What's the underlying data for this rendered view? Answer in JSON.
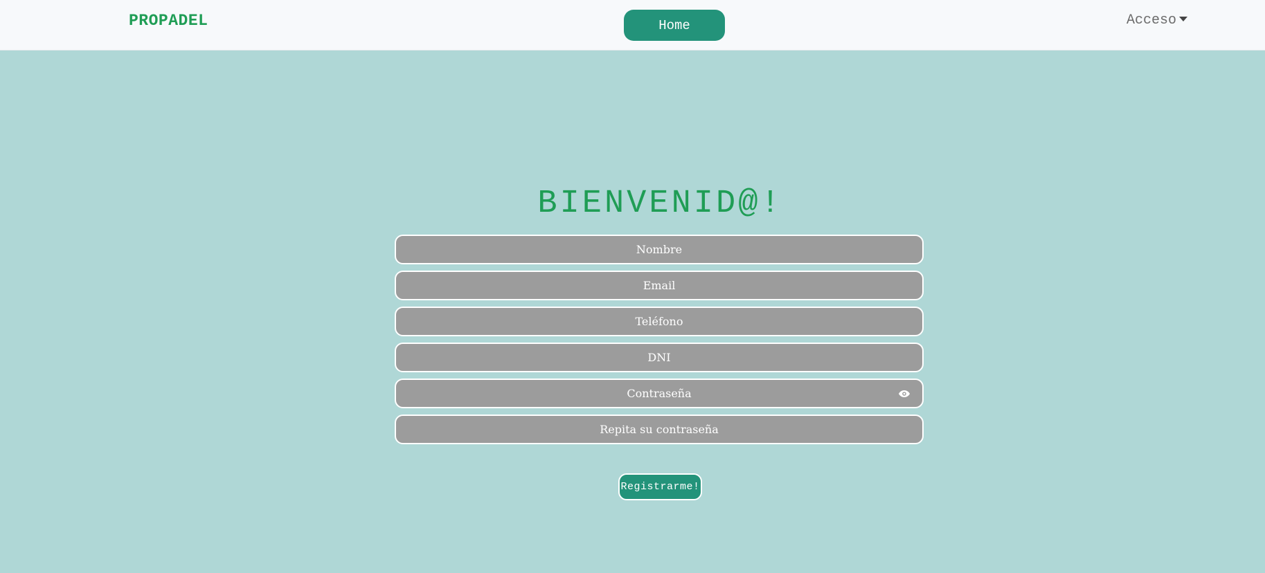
{
  "navbar": {
    "brand": "PROPADEL",
    "home_label": "Home",
    "acceso_label": "Acceso"
  },
  "form": {
    "title": "BIENVENID@!",
    "fields": [
      {
        "placeholder": "Nombre"
      },
      {
        "placeholder": "Email"
      },
      {
        "placeholder": "Teléfono"
      },
      {
        "placeholder": "DNI"
      },
      {
        "placeholder": "Contraseña"
      },
      {
        "placeholder": "Repita su contraseña"
      }
    ],
    "submit_label": "Registrarme!"
  },
  "colors": {
    "background": "#afd7d6",
    "navbar": "#f7f9fb",
    "accent_green": "#1f9d55",
    "button_teal": "#23937a",
    "field_gray": "#9c9c9c"
  },
  "icons": {
    "password_toggle": "eye-icon",
    "dropdown": "caret-down-icon"
  }
}
